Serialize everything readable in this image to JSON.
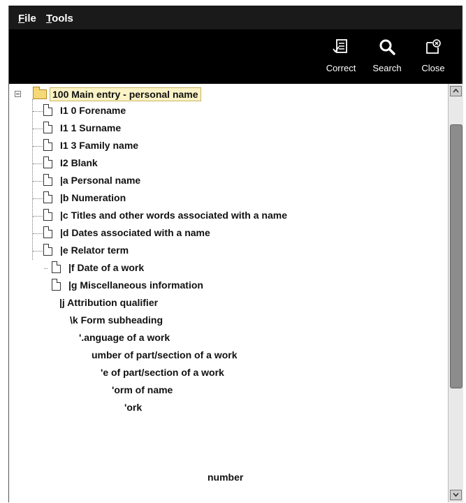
{
  "menu": {
    "file_prefix": "F",
    "file_rest": "ile",
    "tools_prefix": "T",
    "tools_rest": "ools"
  },
  "toolbar": [
    {
      "label": "Correct",
      "icon": "correct-icon"
    },
    {
      "label": "Search",
      "icon": "search-icon"
    },
    {
      "label": "Close",
      "icon": "close-icon"
    }
  ],
  "tree": {
    "root": "100 Main entry - personal name",
    "items": [
      "I1 0 Forename",
      "I1 1 Surname",
      "I1 3 Family name",
      "I2 Blank",
      "|a Personal name",
      "|b Numeration",
      "|c Titles and other words associated with a name",
      "|d Dates associated with a name",
      "|e Relator term",
      "|f Date of a work",
      "|g Miscellaneous information",
      "|j Attribution qualifier",
      "\\k Form subheading",
      "'.anguage of a work",
      "umber of part/section of a work",
      "'e of part/section of a work",
      "'orm of name",
      "'ork",
      "number"
    ]
  }
}
